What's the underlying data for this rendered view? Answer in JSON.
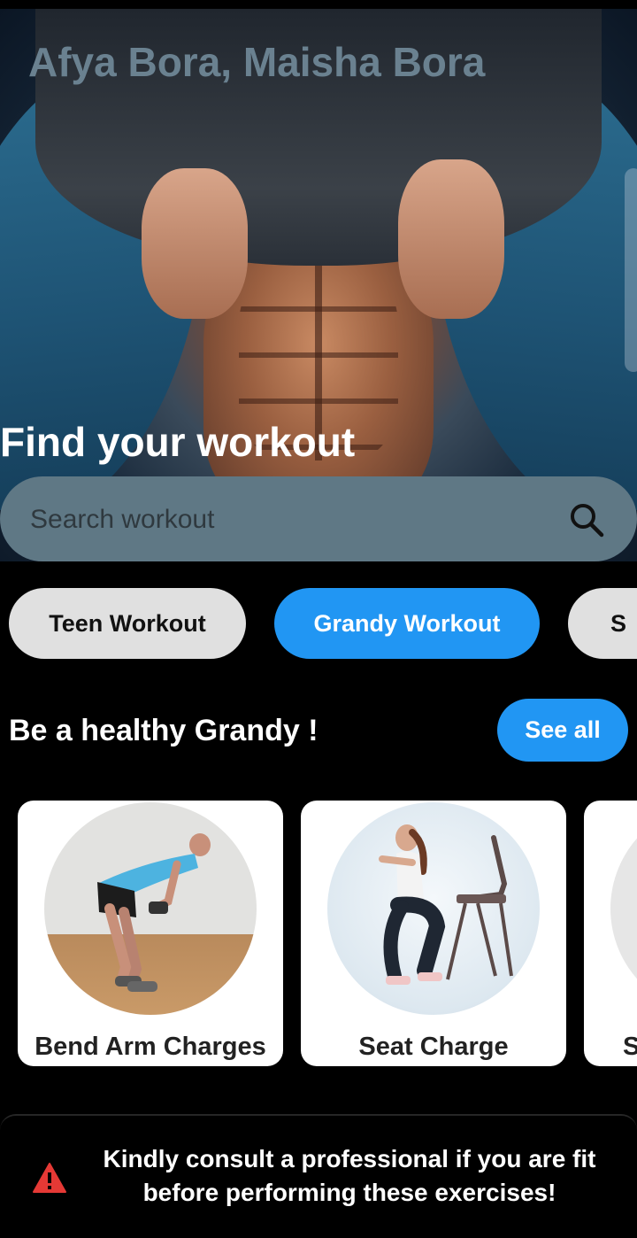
{
  "app": {
    "brand_title": "Afya Bora, Maisha Bora",
    "find_title": "Find your workout"
  },
  "search": {
    "placeholder": "Search workout",
    "icon": "search-icon"
  },
  "categories": [
    {
      "label": "Teen Workout",
      "selected": false
    },
    {
      "label": "Grandy Workout",
      "selected": true
    },
    {
      "label": "S",
      "selected": false
    }
  ],
  "section": {
    "title": "Be a healthy Grandy !",
    "see_all_label": "See all"
  },
  "exercises": [
    {
      "label": "Bend Arm Charges"
    },
    {
      "label": "Seat Charge"
    },
    {
      "label": "S"
    }
  ],
  "warning": {
    "icon": "warning-icon",
    "text": "Kindly consult a professional if you are fit before performing these exercises!"
  },
  "colors": {
    "accent": "#2196f3",
    "chip_inactive": "#e0e0e0",
    "search_bg": "#5f7885",
    "warning": "#e53935"
  }
}
